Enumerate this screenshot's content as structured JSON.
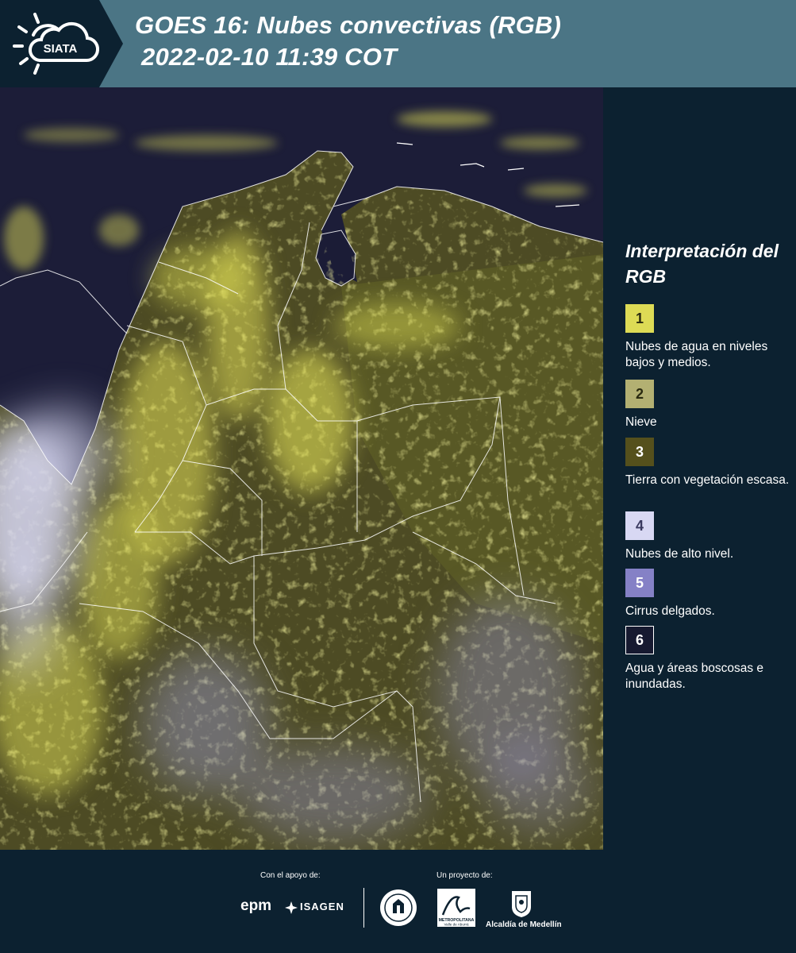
{
  "header": {
    "logo_text": "SIATA",
    "title_line1": "GOES 16: Nubes convectivas (RGB)",
    "title_line2": "2022-02-10 11:39 COT"
  },
  "map": {
    "imagery": "satellite-rgb-convective-clouds",
    "region": "Colombia"
  },
  "legend": {
    "title": "Interpretación del RGB",
    "items": [
      {
        "number": "1",
        "label": "Nubes de agua en niveles bajos y medios.",
        "color": "#dddb55",
        "text_color": "#2a2a10"
      },
      {
        "number": "2",
        "label": "Nieve",
        "color": "#b3b072",
        "text_color": "#2a2a10"
      },
      {
        "number": "3",
        "label": "Tierra con vegetación escasa.",
        "color": "#55501c",
        "text_color": "#ffffff"
      },
      {
        "number": "4",
        "label": "Nubes de alto nivel.",
        "color": "#d8d8f3",
        "text_color": "#3a3a60"
      },
      {
        "number": "5",
        "label": "Cirrus delgados.",
        "color": "#8581c6",
        "text_color": "#ffffff"
      },
      {
        "number": "6",
        "label": "Agua y áreas boscosas e inundadas.",
        "color": "#171a30",
        "text_color": "#ffffff"
      }
    ]
  },
  "footer": {
    "support_caption": "Con el apoyo de:",
    "project_caption": "Un proyecto de:",
    "epm": "epm",
    "isagen": "ISAGEN",
    "metropolitana": "METROPOLITANA",
    "valle": "Valle de Aburrá",
    "alcaldia": "Alcaldía de Medellín"
  },
  "colors": {
    "background": "#0c2130",
    "header": "#4b7585",
    "cloud_yellow": "#e1df55",
    "vegetation": "#5a5a26",
    "high_cloud": "#d8d8f3",
    "water": "#1c1d38"
  }
}
